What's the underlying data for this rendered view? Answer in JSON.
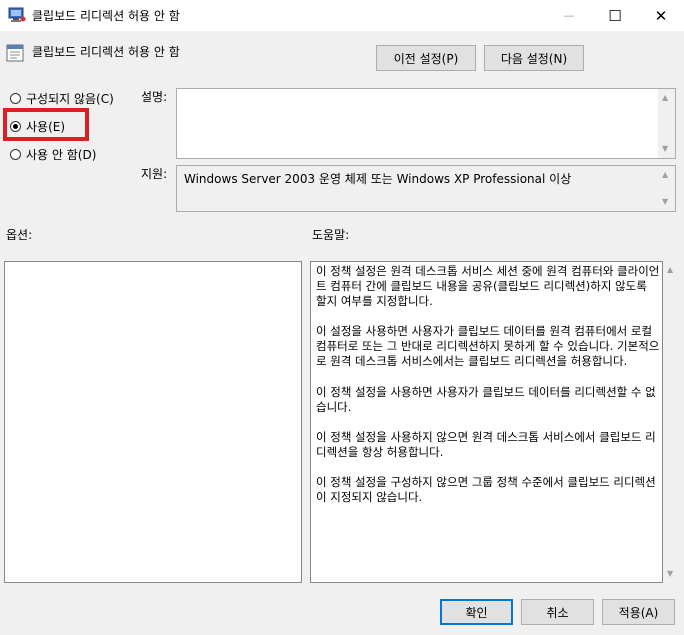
{
  "window": {
    "title": "클립보드 리디렉션 허용 안 함",
    "minimize_glyph": "—",
    "maximize_glyph": "☐",
    "close_glyph": "✕"
  },
  "header": {
    "policy_title": "클립보드 리디렉션 허용 안 함",
    "prev_button": "이전 설정(P)",
    "next_button": "다음 설정(N)"
  },
  "state": {
    "options": [
      {
        "label": "구성되지 않음(C)",
        "checked": false
      },
      {
        "label": "사용(E)",
        "checked": true
      },
      {
        "label": "사용 안 함(D)",
        "checked": false
      }
    ],
    "highlight_color": "#e11d24"
  },
  "comment": {
    "label": "설명:",
    "value": ""
  },
  "supported_on": {
    "label": "지원:",
    "value": "Windows Server 2003 운영 체제 또는 Windows XP Professional 이상"
  },
  "options_label": "옵션:",
  "help": {
    "label": "도움말:",
    "paragraphs": [
      "이 정책 설정은 원격 데스크톱 서비스 세션 중에 원격 컴퓨터와 클라이언트 컴퓨터 간에 클립보드 내용을 공유(클립보드 리디렉션)하지 않도록 할지 여부를 지정합니다.",
      "이 설정을 사용하면 사용자가 클립보드 데이터를 원격 컴퓨터에서 로컬 컴퓨터로 또는 그 반대로 리디렉션하지 못하게 할 수 있습니다. 기본적으로 원격 데스크톱 서비스에서는 클립보드 리디렉션을 허용합니다.",
      "이 정책 설정을 사용하면 사용자가 클립보드 데이터를 리디렉션할 수 없습니다.",
      "이 정책 설정을 사용하지 않으면 원격 데스크톱 서비스에서 클립보드 리디렉션을 항상 허용합니다.",
      "이 정책 설정을 구성하지 않으면 그룹 정책 수준에서 클립보드 리디렉션이 지정되지 않습니다."
    ]
  },
  "footer": {
    "ok": "확인",
    "cancel": "취소",
    "apply": "적용(A)"
  }
}
